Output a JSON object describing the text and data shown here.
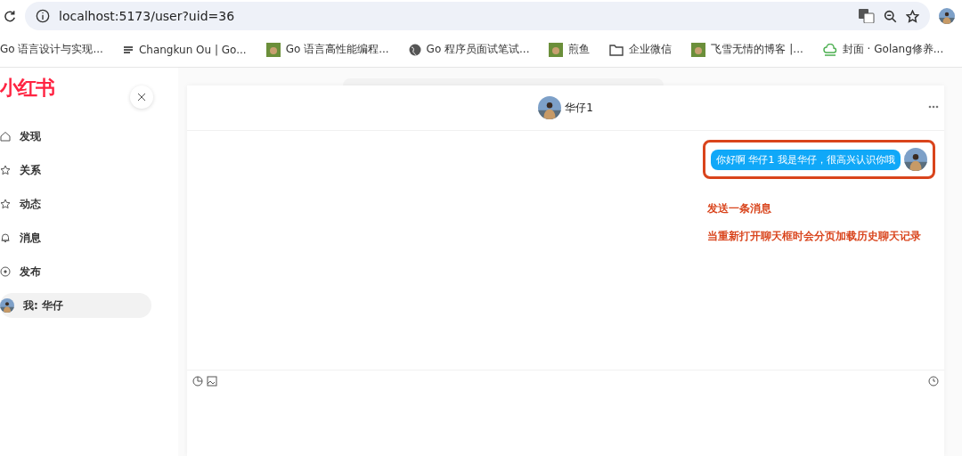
{
  "browser": {
    "url": "localhost:5173/user?uid=36",
    "bookmarks": [
      {
        "label": "Go 语言设计与实现...",
        "kind": "none"
      },
      {
        "label": "Changkun Ou | Go...",
        "kind": "lines"
      },
      {
        "label": "Go 语言高性能编程...",
        "kind": "image"
      },
      {
        "label": "Go 程序员面试笔试...",
        "kind": "globe"
      },
      {
        "label": "煎鱼",
        "kind": "image"
      },
      {
        "label": "企业微信",
        "kind": "folder"
      },
      {
        "label": "飞雪无情的博客 |...",
        "kind": "image"
      },
      {
        "label": "封面 · Golang修养...",
        "kind": "cloud"
      }
    ]
  },
  "sidebar": {
    "logo": "小红书",
    "items": [
      {
        "label": "发现",
        "kind": "home",
        "selected": false
      },
      {
        "label": "关系",
        "kind": "star",
        "selected": false
      },
      {
        "label": "动态",
        "kind": "star",
        "selected": false
      },
      {
        "label": "消息",
        "kind": "bell",
        "selected": false
      },
      {
        "label": "发布",
        "kind": "plus",
        "selected": false
      },
      {
        "label": "我: 华仔",
        "kind": "avatar",
        "selected": true
      }
    ]
  },
  "chat": {
    "title": "华仔1",
    "messages": [
      {
        "text": "你好啊 华仔1 我是华仔，很高兴认识你哦",
        "highlighted": true
      }
    ],
    "notes": [
      "发送一条消息",
      "当重新打开聊天框时会分页加载历史聊天记录"
    ]
  }
}
